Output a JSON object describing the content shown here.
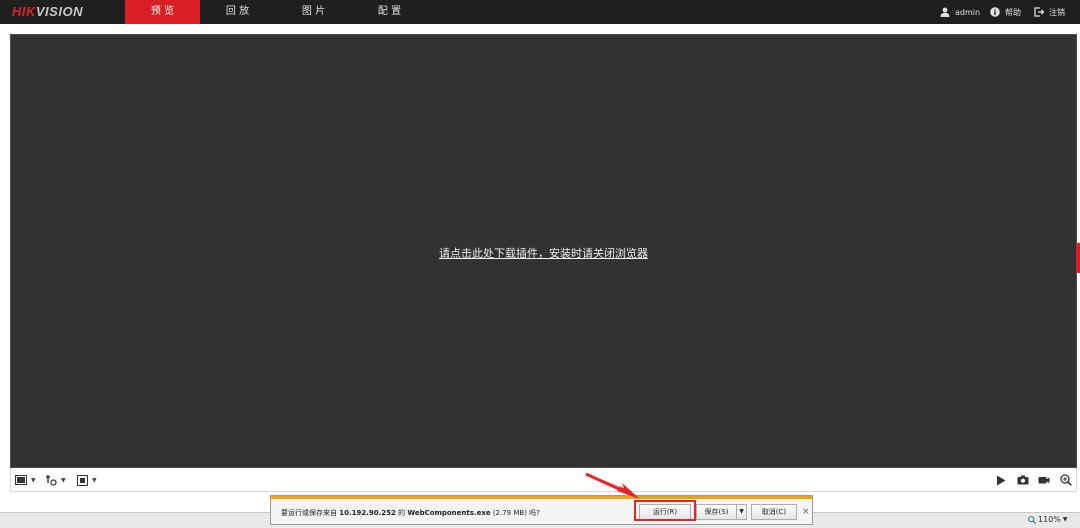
{
  "header": {
    "logo_red": "HIK",
    "logo_rest": "VISION",
    "tabs": [
      {
        "label": "预 览",
        "active": true
      },
      {
        "label": "回 放",
        "active": false
      },
      {
        "label": "图 片",
        "active": false
      },
      {
        "label": "配 置",
        "active": false
      }
    ],
    "user": "admin",
    "help": "帮助",
    "logout": "注销"
  },
  "video": {
    "plugin_message": "请点击此处下载插件，安装时请关闭浏览器"
  },
  "download_bar": {
    "prefix": "要运行或保存来自",
    "host": "10.192.90.252",
    "mid": "的",
    "filename": "WebComponents.exe",
    "size": "(2.79 MB)",
    "suffix": "吗?",
    "run_label": "运行(R)",
    "save_label": "保存(S)",
    "cancel_label": "取消(C)",
    "close_glyph": "×"
  },
  "browser": {
    "zoom": "110%"
  },
  "colors": {
    "accent_red": "#d71f25",
    "topbar_bg": "#1f1f1f",
    "video_bg": "#333232",
    "notify_orange": "#f0a30a"
  },
  "icons": {
    "user": "user-icon",
    "help": "info-icon",
    "logout": "logout-icon",
    "toolbar_left": [
      "window-layout-icon",
      "stream-type-icon",
      "fullscreen-icon"
    ],
    "toolbar_right": [
      "play-icon",
      "camera-icon",
      "record-icon",
      "zoom-in-icon"
    ]
  }
}
